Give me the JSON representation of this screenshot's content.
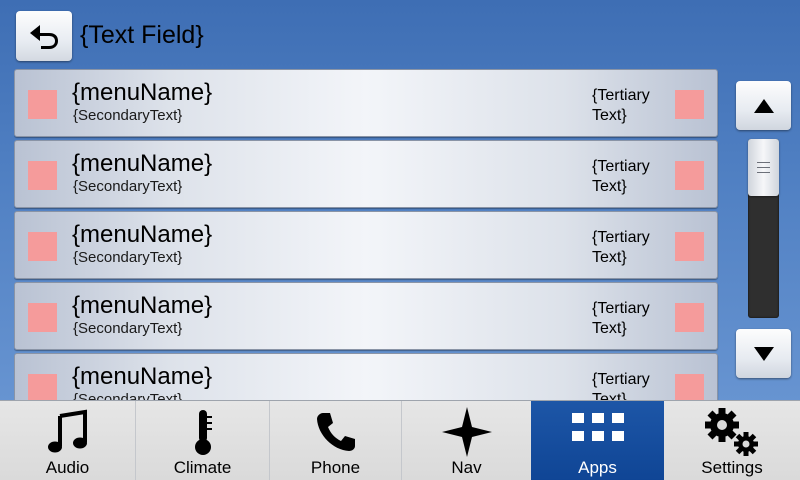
{
  "header": {
    "back_icon": "back-arrow-icon",
    "title": "{Text Field}"
  },
  "list": {
    "items": [
      {
        "menu_name": "{menuName}",
        "secondary": "{SecondaryText}",
        "tertiary_line1": "{Tertiary",
        "tertiary_line2": "Text}"
      },
      {
        "menu_name": "{menuName}",
        "secondary": "{SecondaryText}",
        "tertiary_line1": "{Tertiary",
        "tertiary_line2": "Text}"
      },
      {
        "menu_name": "{menuName}",
        "secondary": "{SecondaryText}",
        "tertiary_line1": "{Tertiary",
        "tertiary_line2": "Text}"
      },
      {
        "menu_name": "{menuName}",
        "secondary": "{SecondaryText}",
        "tertiary_line1": "{Tertiary",
        "tertiary_line2": "Text}"
      },
      {
        "menu_name": "{menuName}",
        "secondary": "{SecondaryText}",
        "tertiary_line1": "{Tertiary",
        "tertiary_line2": "Text}"
      }
    ],
    "swatch_color": "#f59b9b"
  },
  "scroll": {
    "up_icon": "triangle-up-icon",
    "down_icon": "triangle-down-icon"
  },
  "nav": {
    "items": [
      {
        "label": "Audio",
        "icon": "music-note-icon",
        "active": false
      },
      {
        "label": "Climate",
        "icon": "thermometer-icon",
        "active": false
      },
      {
        "label": "Phone",
        "icon": "phone-icon",
        "active": false
      },
      {
        "label": "Nav",
        "icon": "compass-star-icon",
        "active": false
      },
      {
        "label": "Apps",
        "icon": "apps-grid-icon",
        "active": true
      },
      {
        "label": "Settings",
        "icon": "gears-icon",
        "active": false
      }
    ],
    "active_color": "#1d56a7"
  }
}
